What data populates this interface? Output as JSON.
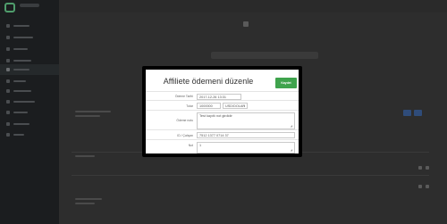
{
  "modal": {
    "title": "Affiliete ödemeni düzenle",
    "save_label": "Kaydet",
    "fields": {
      "payment_date": {
        "label": "Ödeme Tarihi",
        "value": "2017-12-26 13:31"
      },
      "amount": {
        "label": "Tutar",
        "value": "1000000",
        "currency": "USD/DOLAR"
      },
      "description": {
        "label": "Ödeme notu",
        "value": "Test kayıtlı not girdidir"
      },
      "transfer_id": {
        "label": "ID / Çalışan",
        "value": "7512 1377 0714 37"
      },
      "note": {
        "label": "Not",
        "value": "1"
      }
    }
  },
  "colors": {
    "primary_button": "#3fa34d",
    "overlay": "#2b2b2b",
    "sidebar": "#1b1d1f"
  }
}
